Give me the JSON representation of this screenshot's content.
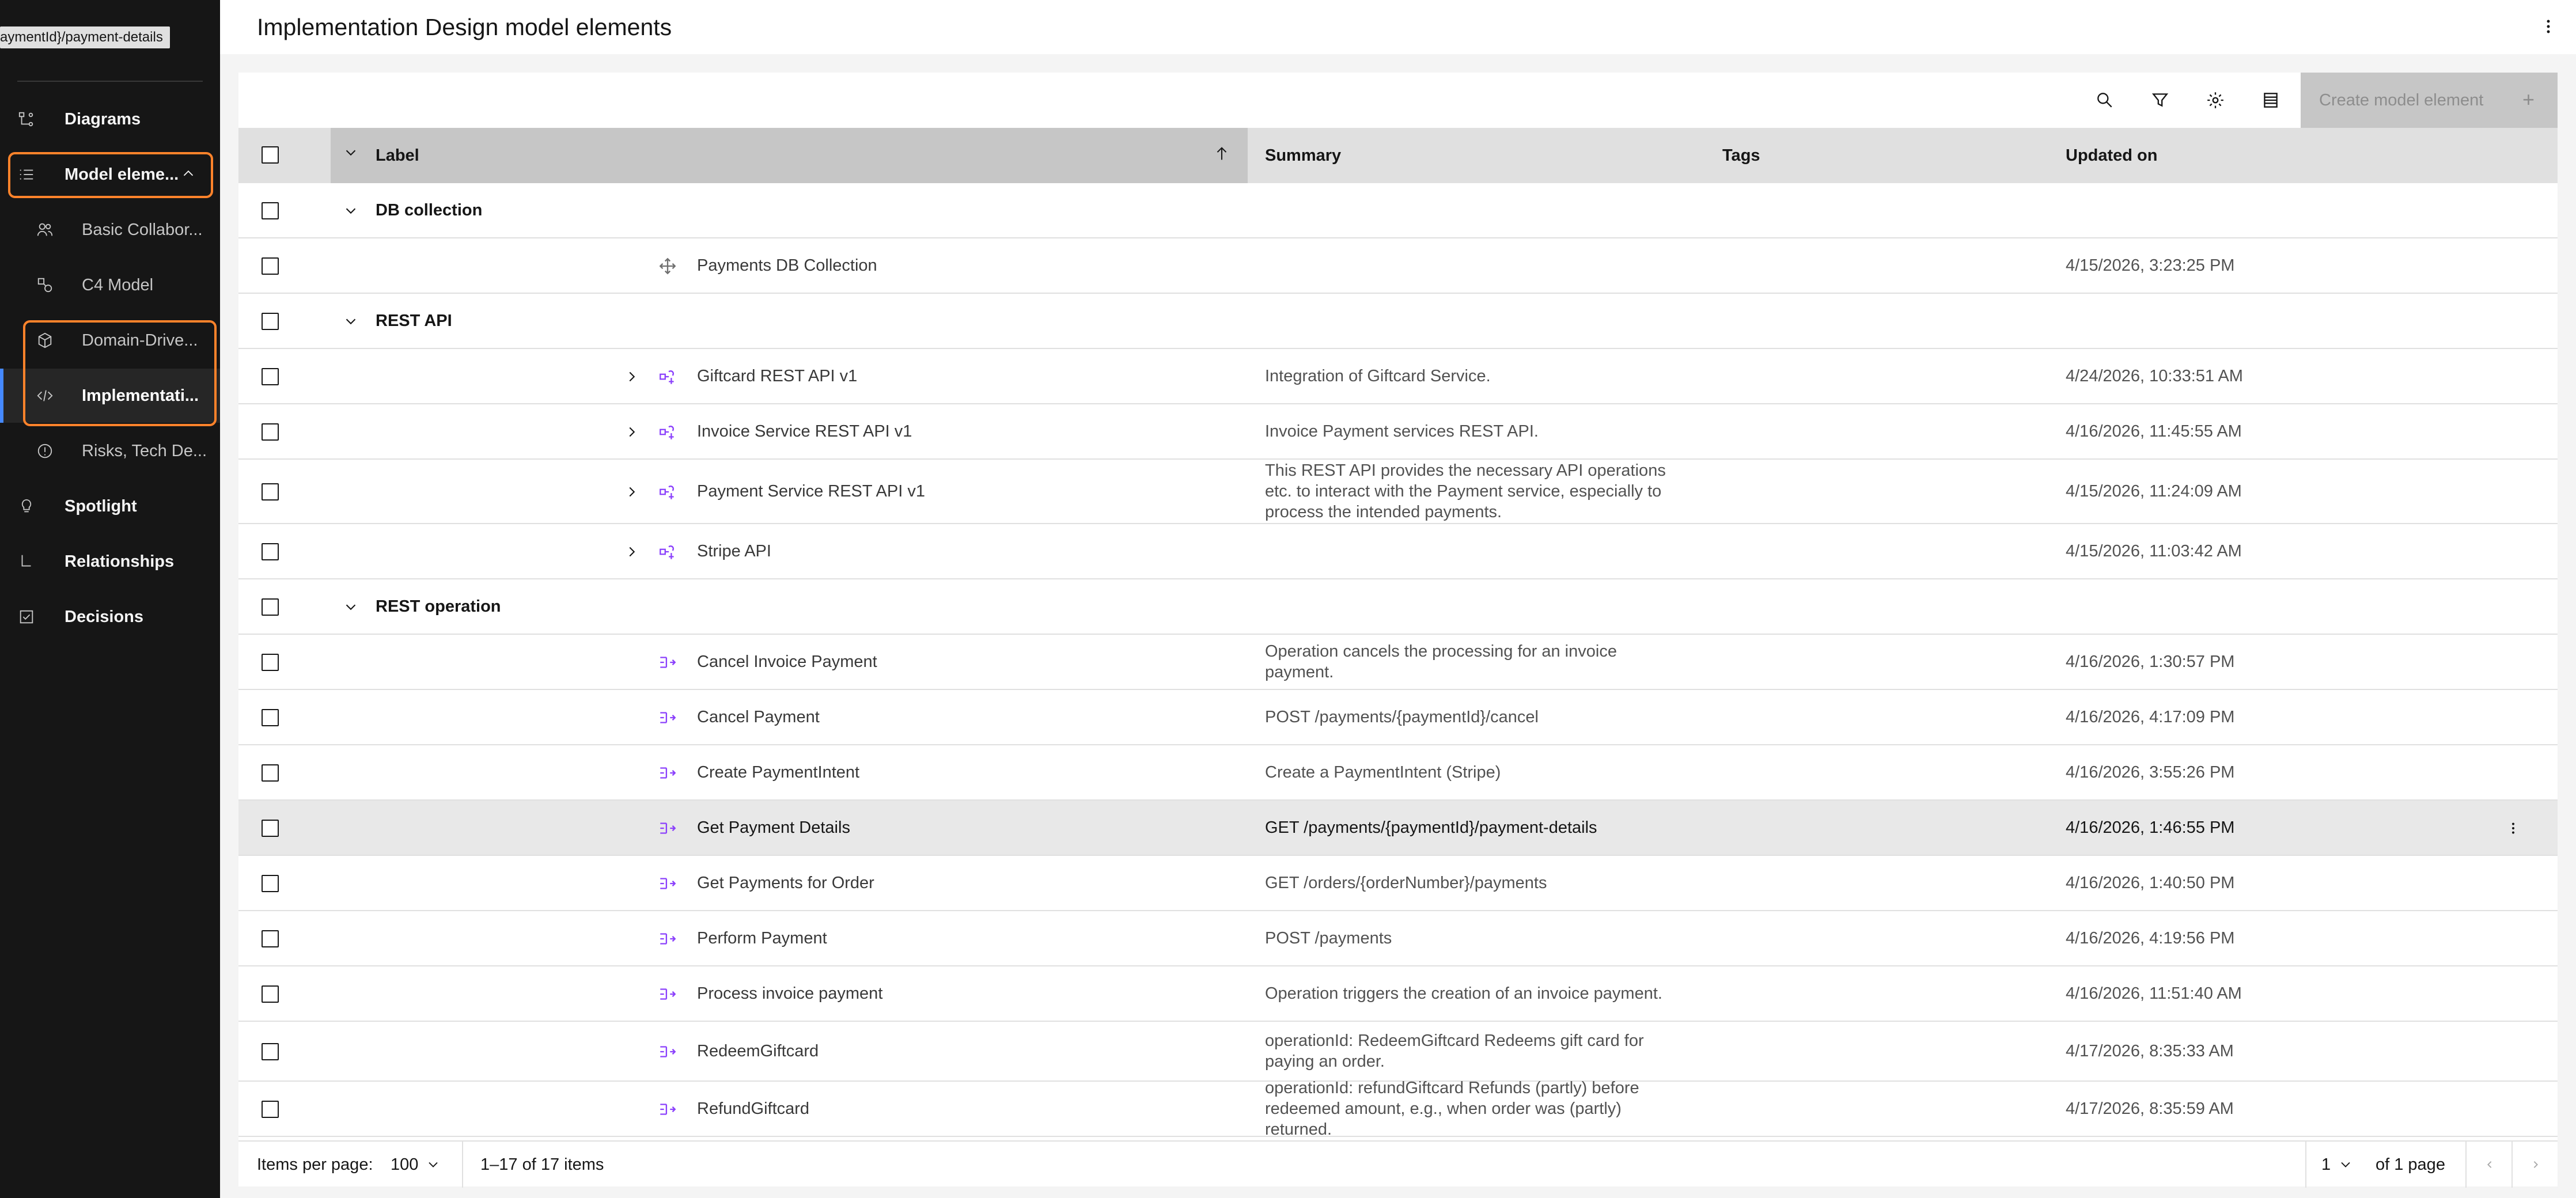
{
  "tooltip": "aymentId}/payment-details",
  "sidebar": {
    "items": [
      {
        "label": "Diagrams",
        "icon": "diagram-icon",
        "level": "top"
      },
      {
        "label": "Model eleme...",
        "icon": "list-icon",
        "level": "top",
        "expanded": true
      },
      {
        "label": "Basic Collabor...",
        "icon": "user-group-icon",
        "level": "sub"
      },
      {
        "label": "C4 Model",
        "icon": "c4-icon",
        "level": "sub"
      },
      {
        "label": "Domain-Drive...",
        "icon": "cube-icon",
        "level": "sub"
      },
      {
        "label": "Implementati...",
        "icon": "code-icon",
        "level": "sub",
        "active": true
      },
      {
        "label": "Risks, Tech De...",
        "icon": "warning-icon",
        "level": "sub"
      },
      {
        "label": "Spotlight",
        "icon": "lightbulb-icon",
        "level": "top"
      },
      {
        "label": "Relationships",
        "icon": "relationship-icon",
        "level": "top"
      },
      {
        "label": "Decisions",
        "icon": "checkbox-checked-icon",
        "level": "top"
      }
    ]
  },
  "header": {
    "title": "Implementation Design model elements"
  },
  "toolbar": {
    "create_label": "Create model element",
    "create_plus": "+"
  },
  "table": {
    "columns": {
      "label": "Label",
      "summary": "Summary",
      "tags": "Tags",
      "updated": "Updated on"
    },
    "rows": [
      {
        "type": "group",
        "label": "DB collection"
      },
      {
        "type": "item",
        "icon": "db-collection-icon",
        "label": "Payments DB Collection",
        "summary": "",
        "updated": "4/15/2026, 3:23:25 PM"
      },
      {
        "type": "group",
        "label": "REST API"
      },
      {
        "type": "item",
        "expandable": true,
        "icon": "rest-api-icon",
        "label": "Giftcard REST API v1",
        "summary": "Integration of Giftcard Service.",
        "updated": "4/24/2026, 10:33:51 AM"
      },
      {
        "type": "item",
        "expandable": true,
        "icon": "rest-api-icon",
        "label": "Invoice Service REST API v1",
        "summary": "Invoice Payment services REST API.",
        "updated": "4/16/2026, 11:45:55 AM"
      },
      {
        "type": "item",
        "expandable": true,
        "icon": "rest-api-icon",
        "label": "Payment Service REST API v1",
        "summary": "This REST API provides the necessary API operations etc. to interact with the Payment service, especially to process the intended payments.",
        "updated": "4/15/2026, 11:24:09 AM"
      },
      {
        "type": "item",
        "expandable": true,
        "icon": "rest-api-icon",
        "label": "Stripe API",
        "summary": "",
        "updated": "4/15/2026, 11:03:42 AM"
      },
      {
        "type": "group",
        "label": "REST operation"
      },
      {
        "type": "item",
        "icon": "rest-operation-icon",
        "label": "Cancel Invoice Payment",
        "summary": "Operation cancels the processing for an invoice payment.",
        "updated": "4/16/2026, 1:30:57 PM"
      },
      {
        "type": "item",
        "icon": "rest-operation-icon",
        "label": "Cancel Payment",
        "summary": "POST /payments/{paymentId}/cancel",
        "updated": "4/16/2026, 4:17:09 PM"
      },
      {
        "type": "item",
        "icon": "rest-operation-icon",
        "label": "Create PaymentIntent",
        "summary": "Create a PaymentIntent (Stripe)",
        "updated": "4/16/2026, 3:55:26 PM"
      },
      {
        "type": "item",
        "icon": "rest-operation-icon",
        "label": "Get Payment Details",
        "summary": "GET /payments/{paymentId}/payment-details",
        "updated": "4/16/2026, 1:46:55 PM",
        "selected": true
      },
      {
        "type": "item",
        "icon": "rest-operation-icon",
        "label": "Get Payments for Order",
        "summary": "GET /orders/{orderNumber}/payments",
        "updated": "4/16/2026, 1:40:50 PM"
      },
      {
        "type": "item",
        "icon": "rest-operation-icon",
        "label": "Perform Payment",
        "summary": "POST /payments",
        "updated": "4/16/2026, 4:19:56 PM"
      },
      {
        "type": "item",
        "icon": "rest-operation-icon",
        "label": "Process invoice payment",
        "summary": "Operation triggers the creation of an invoice payment.",
        "updated": "4/16/2026, 11:51:40 AM"
      },
      {
        "type": "item",
        "icon": "rest-operation-icon",
        "label": "RedeemGiftcard",
        "summary": "operationId: RedeemGiftcard Redeems gift card for paying an order.",
        "updated": "4/17/2026, 8:35:33 AM"
      },
      {
        "type": "item",
        "icon": "rest-operation-icon",
        "label": "RefundGiftcard",
        "summary": "operationId: refundGiftcard Refunds (partly) before redeemed amount, e.g., when order was (partly) returned.",
        "updated": "4/17/2026, 8:35:59 AM"
      }
    ]
  },
  "pagination": {
    "items_per_page_label": "Items per page:",
    "items_per_page_value": "100",
    "range_text": "1–17 of 17 items",
    "page_value": "1",
    "page_total_text": "of 1 page"
  },
  "colors": {
    "accent": "#4589ff",
    "focus": "#ff832b",
    "icon_purple": "#8a3ffc",
    "sidebar_bg": "#161616"
  }
}
